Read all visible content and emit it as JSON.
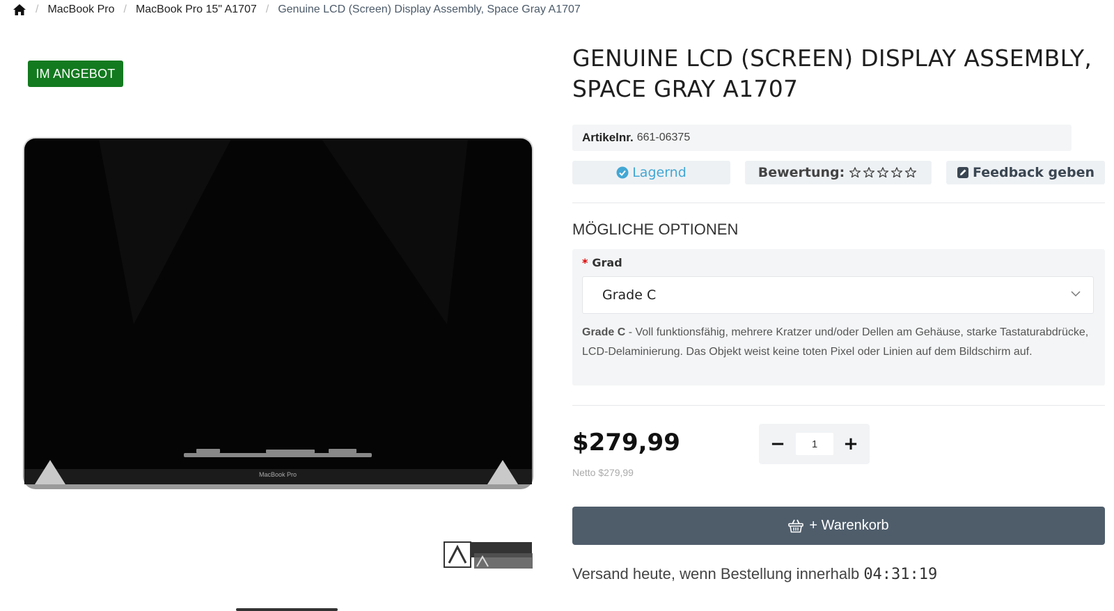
{
  "breadcrumb": {
    "items": [
      "MacBook Pro",
      "MacBook Pro 15\" A1707"
    ],
    "current": "Genuine LCD (Screen) Display Assembly, Space Gray A1707"
  },
  "badge": "IM ANGEBOT",
  "product": {
    "title": "GENUINE LCD (SCREEN) DISPLAY ASSEMBLY, SPACE GRAY A1707",
    "sku_label": "Artikelnr.",
    "sku_value": "661-06375",
    "image_brand_text": "MacBook Pro"
  },
  "status": {
    "stock": "Lagernd",
    "rating_label": "Bewertung:",
    "rating_value": 0,
    "rating_max": 5,
    "feedback": "Feedback geben"
  },
  "options": {
    "heading": "MÖGLICHE OPTIONEN",
    "required_mark": "*",
    "label": "Grad",
    "selected": "Grade C",
    "desc_grade": "Grade C",
    "desc_text": " - Voll funktionsfähig, mehrere Kratzer und/oder Dellen am Gehäuse, starke Tastaturabdrücke, LCD-Delaminierung. Das Objekt weist keine toten Pixel oder Linien auf dem Bildschirm auf."
  },
  "price": {
    "amount": "$279,99",
    "netto": "Netto $279,99"
  },
  "quantity": {
    "minus": "−",
    "value": "1",
    "plus": "+"
  },
  "cart": {
    "label": "+ Warenkorb"
  },
  "shipping": {
    "text": "Versand heute, wenn Bestellung innerhalb ",
    "timer": "04:31:19"
  },
  "colors": {
    "badge": "#137a1f",
    "stock": "#43a7d4",
    "cart_button": "#4f5d6b"
  },
  "icons": {
    "home": "home-icon",
    "stock": "check-circle-icon",
    "star": "star-outline-icon",
    "feedback": "edit-icon",
    "select": "chevron-down-icon",
    "cart": "basket-icon"
  }
}
